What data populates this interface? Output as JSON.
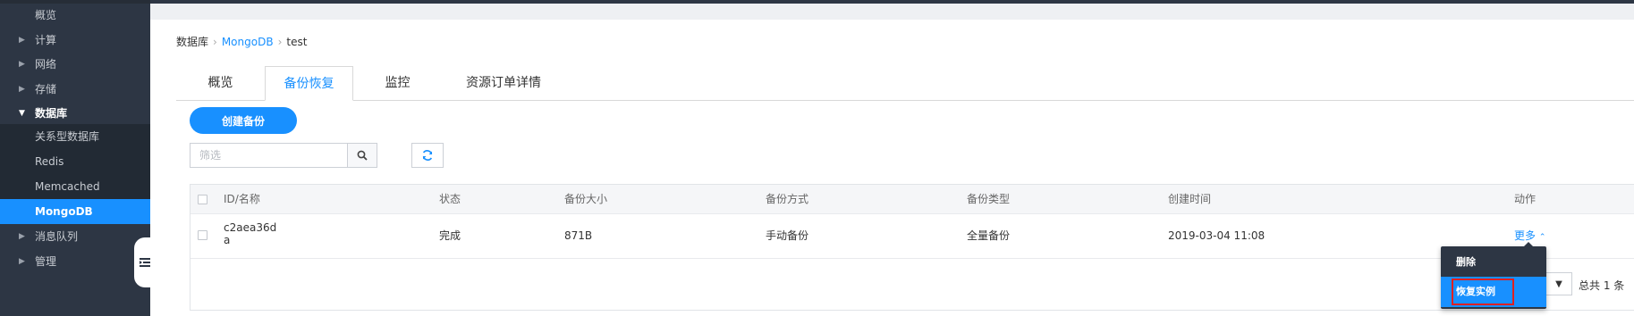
{
  "sidebar": {
    "items": [
      {
        "label": "概览"
      },
      {
        "label": "计算"
      },
      {
        "label": "网络"
      },
      {
        "label": "存储"
      },
      {
        "label": "数据库"
      },
      {
        "label": "关系型数据库"
      },
      {
        "label": "Redis"
      },
      {
        "label": "Memcached"
      },
      {
        "label": "MongoDB"
      },
      {
        "label": "消息队列"
      },
      {
        "label": "管理"
      }
    ]
  },
  "breadcrumb": {
    "root": "数据库",
    "service": "MongoDB",
    "current": "test"
  },
  "tabs": [
    {
      "label": "概览"
    },
    {
      "label": "备份恢复"
    },
    {
      "label": "监控"
    },
    {
      "label": "资源订单详情"
    }
  ],
  "toolbar": {
    "create_label": "创建备份",
    "filter_placeholder": "筛选"
  },
  "table": {
    "headers": [
      "ID/名称",
      "状态",
      "备份大小",
      "备份方式",
      "备份类型",
      "创建时间",
      "动作"
    ],
    "rows": [
      {
        "id_line1": "c2aea36d",
        "id_line2": "a",
        "status": "完成",
        "size": "871B",
        "method": "手动备份",
        "type": "全量备份",
        "created": "2019-03-04 11:08",
        "action": "更多"
      }
    ]
  },
  "dropdown": {
    "items": [
      "删除",
      "恢复实例"
    ]
  },
  "pagination": {
    "total": "总共 1 条"
  },
  "colors": {
    "accent": "#1890ff",
    "sidebar_bg": "#2d3644",
    "highlight_border": "#e02020"
  }
}
